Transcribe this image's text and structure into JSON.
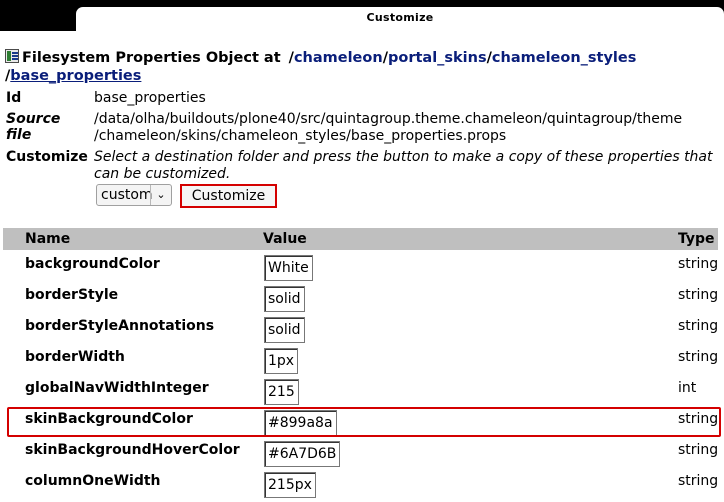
{
  "window": {
    "tab_title": "Customize"
  },
  "header": {
    "label": "Filesystem Properties Object at",
    "path": [
      {
        "text": "/"
      },
      {
        "text": "chameleon"
      },
      {
        "text": "/"
      },
      {
        "text": "portal_skins"
      },
      {
        "text": "/"
      },
      {
        "text": "chameleon_styles"
      },
      {
        "text": "/"
      },
      {
        "text": "base_properties"
      }
    ]
  },
  "info": {
    "id_label": "Id",
    "id_value": "base_properties",
    "source_label": "Source file",
    "source_line1": "/data/olha/buildouts/plone40/src/quintagroup.theme.chameleon/quintagroup/theme",
    "source_line2": "/chameleon/skins/chameleon_styles/base_properties.props",
    "customize_label": "Customize",
    "customize_desc": "Select a destination folder and press the button to make a copy of these properties that can be customized.",
    "folder_selected": "custom",
    "customize_button": "Customize"
  },
  "table": {
    "headers": {
      "name": "Name",
      "value": "Value",
      "type": "Type"
    },
    "rows": [
      {
        "name": "backgroundColor",
        "value": "White",
        "type": "string"
      },
      {
        "name": "borderStyle",
        "value": "solid",
        "type": "string"
      },
      {
        "name": "borderStyleAnnotations",
        "value": "solid",
        "type": "string"
      },
      {
        "name": "borderWidth",
        "value": "1px",
        "type": "string"
      },
      {
        "name": "globalNavWidthInteger",
        "value": "215",
        "type": "int"
      },
      {
        "name": "skinBackgroundColor",
        "value": "#899a8a",
        "type": "string"
      },
      {
        "name": "skinBackgroundHoverColor",
        "value": "#6A7D6B",
        "type": "string"
      },
      {
        "name": "columnOneWidth",
        "value": "215px",
        "type": "string"
      }
    ]
  },
  "colors": {
    "link": "#0a1e7a",
    "highlight": "#d40000",
    "table_header": "#bfbfbf"
  }
}
